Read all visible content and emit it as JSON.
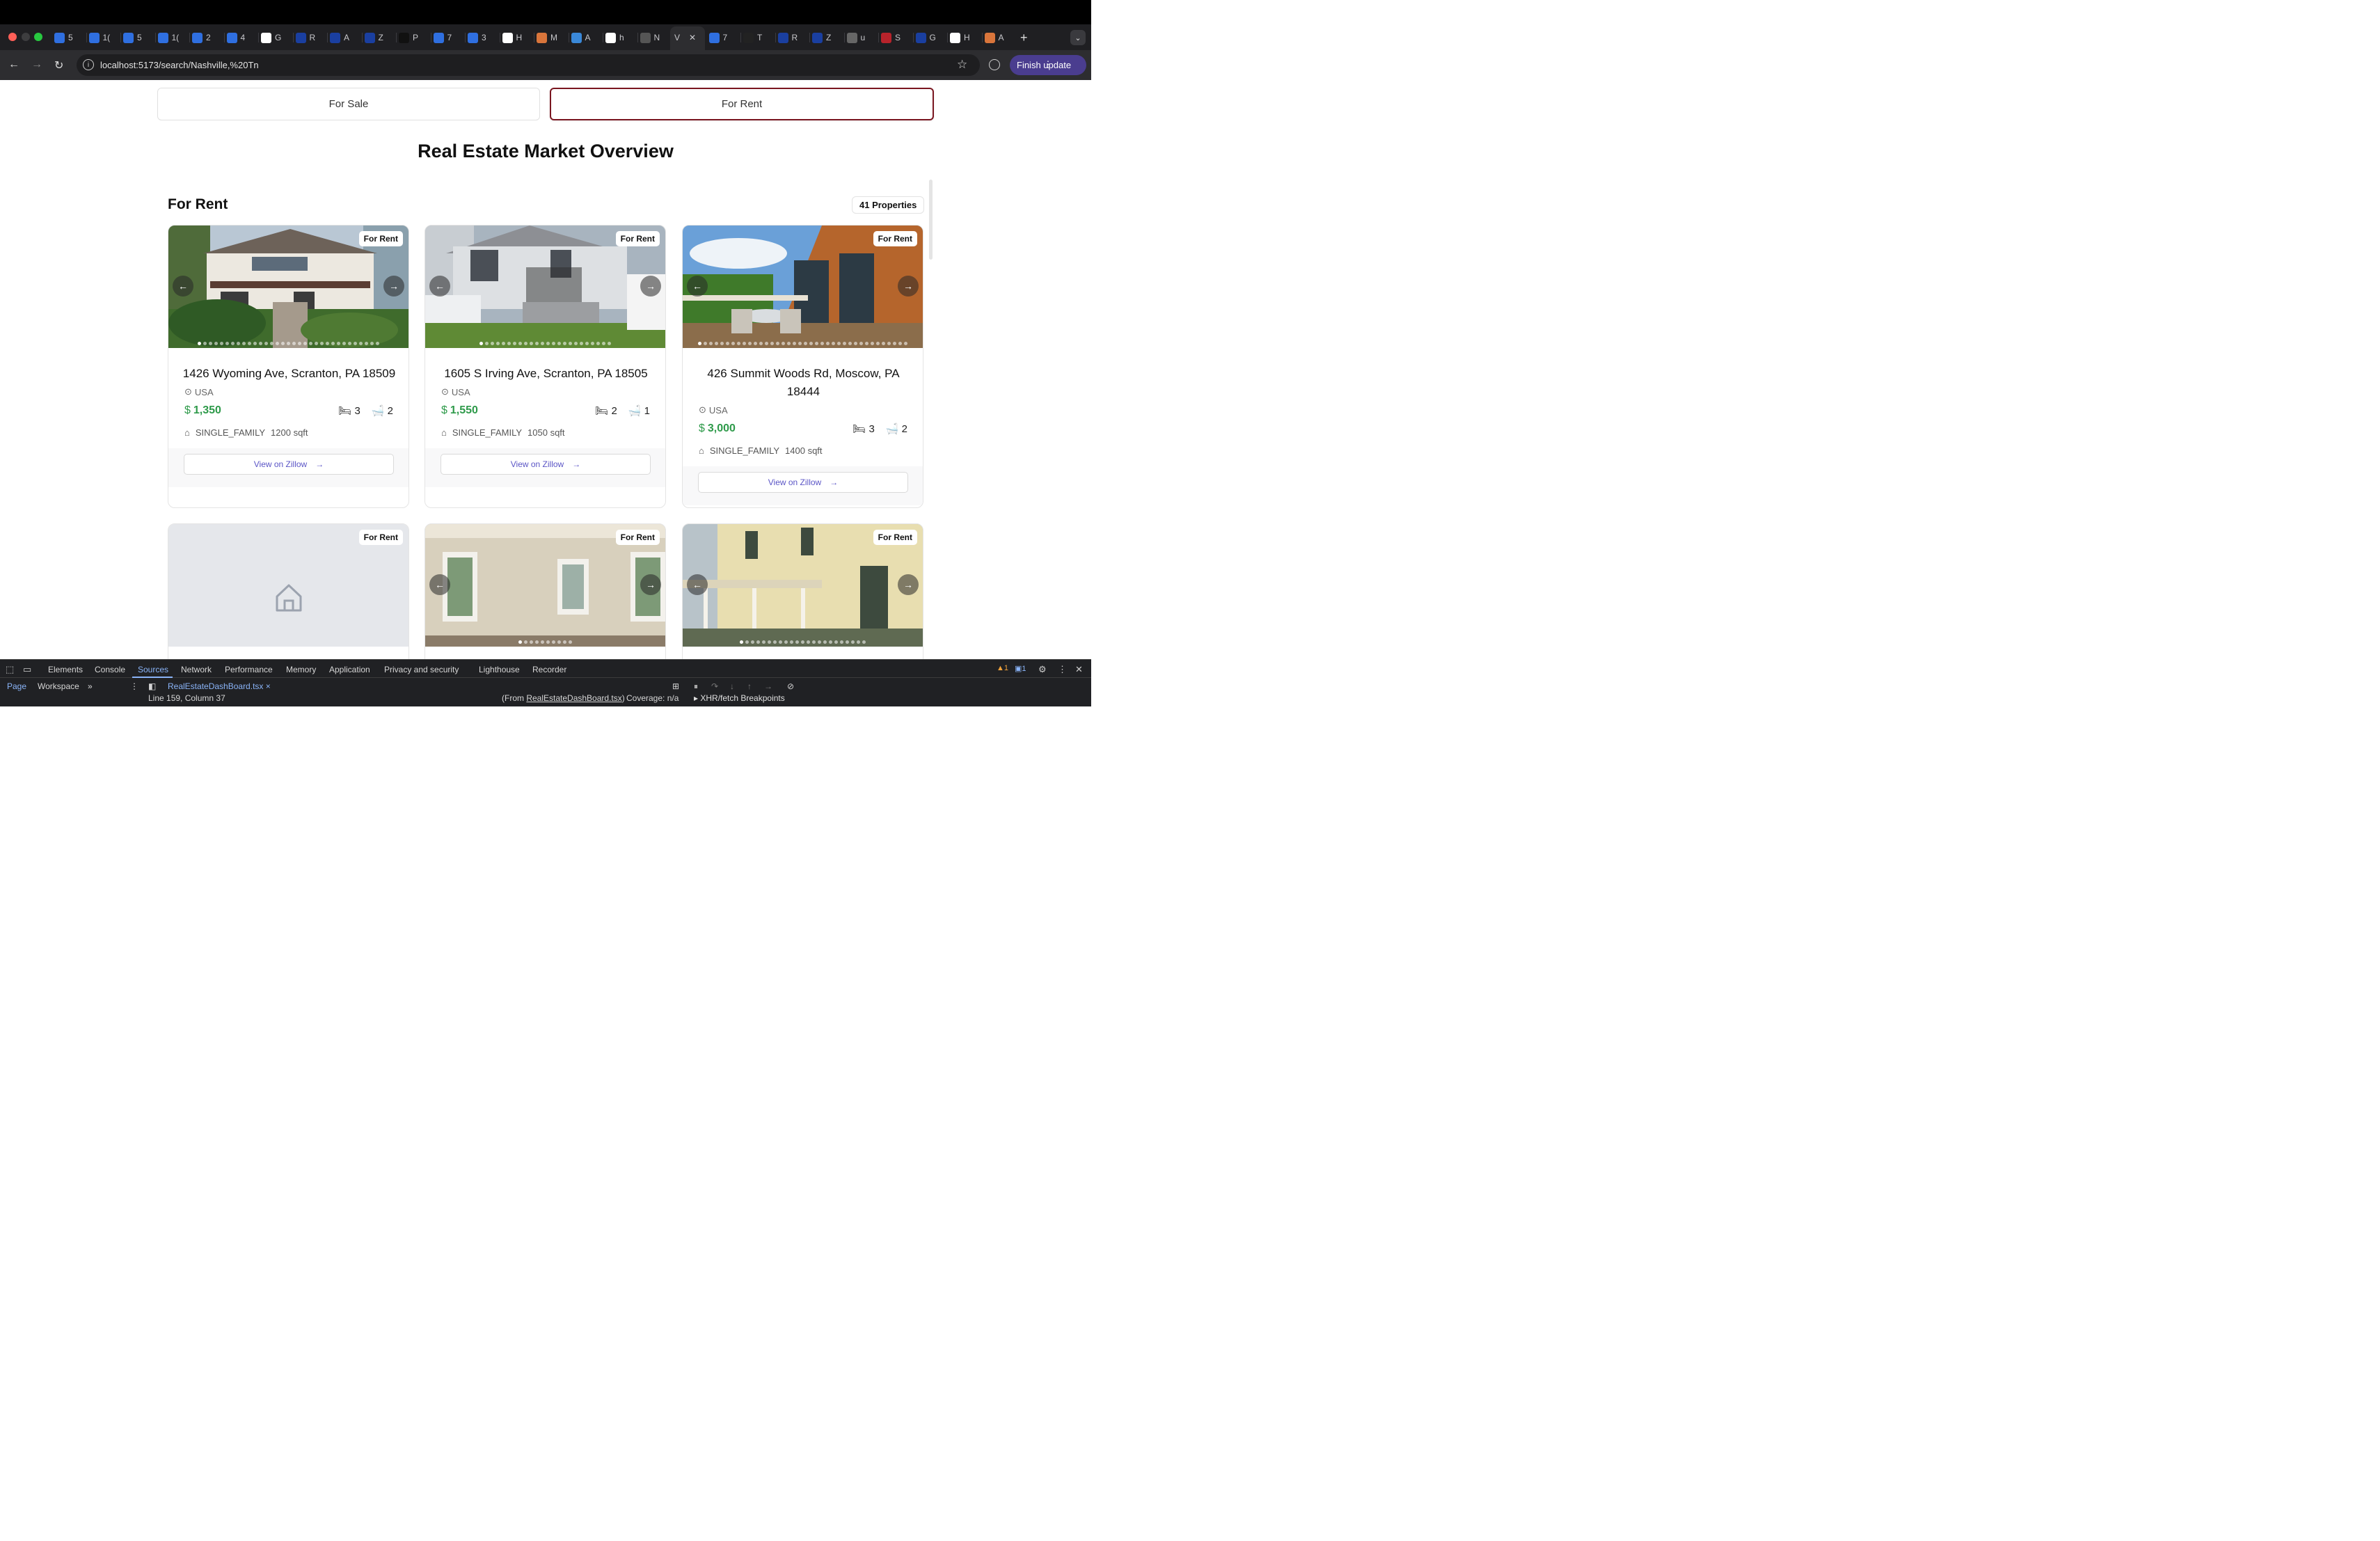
{
  "browser": {
    "tabs": [
      "5",
      "1(",
      "5",
      "1(",
      "2",
      "4",
      "G",
      "R",
      "A",
      "Z",
      "P",
      "7",
      "3",
      "H",
      "M",
      "A",
      "h",
      "N",
      "V",
      "7",
      "T",
      "R",
      "Z",
      "u",
      "S",
      "G",
      "H",
      "A"
    ],
    "url": "localhost:5173/search/Nashville,%20Tn",
    "finish_update": "Finish update"
  },
  "toggle": {
    "sale": "For Sale",
    "rent": "For Rent"
  },
  "page": {
    "title": "Real Estate Market Overview",
    "section": "For Rent",
    "count": "41 Properties"
  },
  "cards": [
    {
      "badge": "For Rent",
      "address": "1426 Wyoming Ave, Scranton, PA 18509",
      "location": "USA",
      "currency": "$",
      "price": "1,350",
      "beds": "3",
      "baths": "2",
      "type": "SINGLE_FAMILY",
      "sqft": "1200 sqft",
      "button": "View on Zillow"
    },
    {
      "badge": "For Rent",
      "address": "1605 S Irving Ave, Scranton, PA 18505",
      "location": "USA",
      "currency": "$",
      "price": "1,550",
      "beds": "2",
      "baths": "1",
      "type": "SINGLE_FAMILY",
      "sqft": "1050 sqft",
      "button": "View on Zillow"
    },
    {
      "badge": "For Rent",
      "address": "426 Summit Woods Rd, Moscow, PA 18444",
      "location": "USA",
      "currency": "$",
      "price": "3,000",
      "beds": "3",
      "baths": "2",
      "type": "SINGLE_FAMILY",
      "sqft": "1400 sqft",
      "button": "View on Zillow"
    },
    {
      "badge": "For Rent"
    },
    {
      "badge": "For Rent"
    },
    {
      "badge": "For Rent"
    }
  ],
  "devtools": {
    "tabs": [
      "Elements",
      "Console",
      "Sources",
      "Network",
      "Performance",
      "Memory",
      "Application",
      "Privacy and security",
      "Lighthouse",
      "Recorder"
    ],
    "page": "Page",
    "workspace": "Workspace",
    "file": "RealEstateDashBoard.tsx",
    "position": "Line 159, Column 37",
    "from_prefix": "(From",
    "from_file": "RealEstateDashBoard.tsx",
    "from_suffix": ")",
    "coverage": "Coverage: n/a",
    "xhr": "XHR/fetch Breakpoints",
    "warnings": "1",
    "messages": "1"
  },
  "colors": {
    "accent": "#7a1620",
    "price": "#2e9a4a",
    "link": "#5b55c6",
    "devtools_active": "#8ab4f8"
  },
  "icons": [
    "back-icon",
    "forward-icon",
    "reload-icon",
    "info-icon",
    "star-icon",
    "profile-icon",
    "location-pin-icon",
    "dollar-icon",
    "bed-icon",
    "bath-icon",
    "house-icon",
    "arrow-right-icon",
    "chevron-left-icon",
    "chevron-right-icon",
    "home-placeholder-icon"
  ]
}
